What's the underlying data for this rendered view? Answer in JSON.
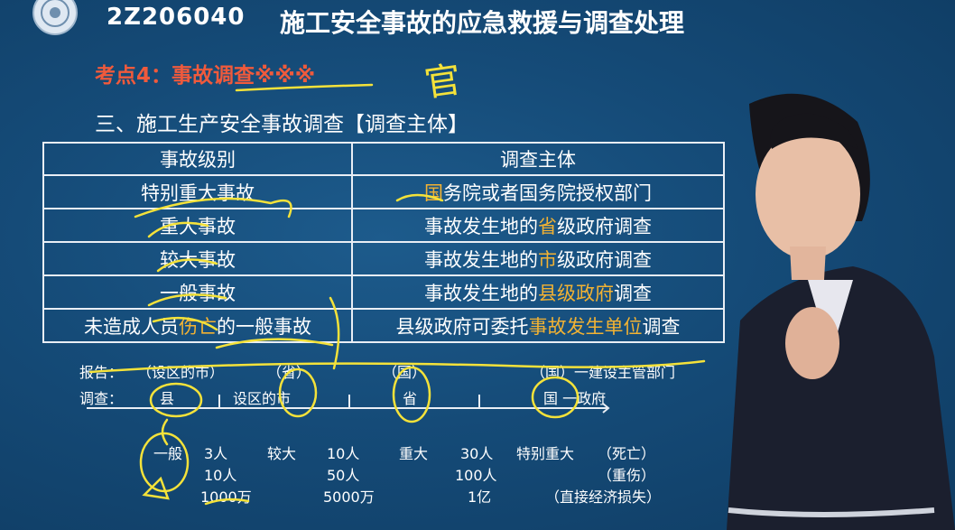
{
  "header": {
    "code": "2Z206040",
    "title": "施工安全事故的应急救援与调查处理"
  },
  "kaodian": "考点4：事故调查※※※",
  "section_title": "三、施工生产安全事故调查【调查主体】",
  "table": {
    "headers": [
      "事故级别",
      "调查主体"
    ],
    "rows": [
      {
        "level": "特别重大事故",
        "body_pre": "",
        "body_hl": "国",
        "body_post": "务院或者国务院授权部门"
      },
      {
        "level": "重大事故",
        "body_pre": "事故发生地的",
        "body_hl": "省",
        "body_post": "级政府调查"
      },
      {
        "level": "较大事故",
        "body_pre": "事故发生地的",
        "body_hl": "市",
        "body_post": "级政府调查"
      },
      {
        "level": "一般事故",
        "body_pre": "事故发生地的",
        "body_hl": "县级政府",
        "body_post": "调查"
      }
    ],
    "last_row": {
      "level_pre": "未造成人员",
      "level_hl": "伤亡",
      "level_post": "的一般事故",
      "body_pre": "县级政府可委托",
      "body_hl": "事故发生单位",
      "body_post": "调查"
    }
  },
  "timeline": {
    "report_label": "报告：",
    "report_items": [
      "（设区的市）",
      "（省）",
      "（国）",
      "（国）一建设主管部门"
    ],
    "investigate_label": "调查：",
    "investigate_items": [
      "县",
      "设区的市",
      "省",
      "国 一政府"
    ]
  },
  "thresholds": {
    "levels": [
      "一般",
      "较大",
      "重大",
      "特别重大"
    ],
    "col1": [
      "3人",
      "10人",
      "1000万"
    ],
    "col2": [
      "10人",
      "50人",
      "5000万"
    ],
    "col3": [
      "30人",
      "100人",
      "1亿"
    ],
    "col4": [
      "（死亡）",
      "（重伤）",
      "（直接经济损失）"
    ]
  },
  "handwritten_note": "官",
  "colors": {
    "background": "#154b78",
    "accent_red": "#f05a3c",
    "highlight": "#f2b233",
    "annotation": "#f4e23a"
  }
}
